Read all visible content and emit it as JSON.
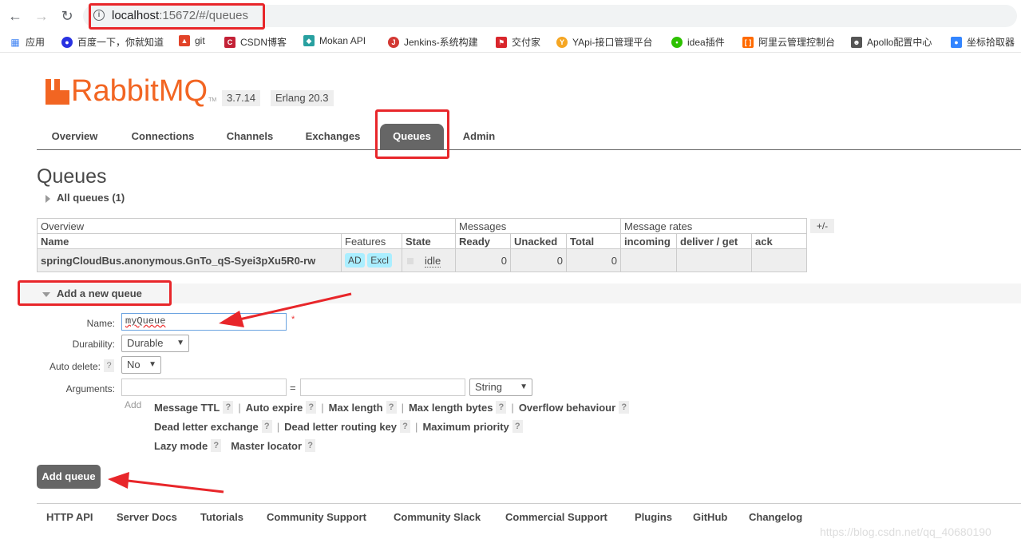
{
  "browser": {
    "url_host": "localhost",
    "url_rest": ":15672/#/queues",
    "bookmarks": [
      {
        "label": "应用",
        "icon": "apps-grid-icon",
        "color": "#4285f4"
      },
      {
        "label": "百度一下，你就知道",
        "icon": "baidu-paw-icon",
        "color": "#2932e1"
      },
      {
        "label": "git",
        "icon": "gitlab-fox-icon",
        "color": "#e24329"
      },
      {
        "label": "CSDN博客",
        "icon": "csdn-c-icon",
        "color": "#c32136"
      },
      {
        "label": "Mokan API",
        "icon": "mokan-diamond-icon",
        "color": "#28a0a0"
      },
      {
        "label": "Jenkins-系统构建",
        "icon": "jenkins-butler-icon",
        "color": "#d33833"
      },
      {
        "label": "交付家",
        "icon": "jiaofujia-flag-icon",
        "color": "#d9262c"
      },
      {
        "label": "YApi-接口管理平台",
        "icon": "yapi-y-icon",
        "color": "#f5a623"
      },
      {
        "label": "idea插件",
        "icon": "wechat-bubble-icon",
        "color": "#2dc100"
      },
      {
        "label": "阿里云管理控制台",
        "icon": "aliyun-bracket-icon",
        "color": "#ff6a00"
      },
      {
        "label": "Apollo配置中心",
        "icon": "apollo-people-icon",
        "color": "#555555"
      },
      {
        "label": "坐标拾取器",
        "icon": "map-pin-icon",
        "color": "#3385ff"
      }
    ]
  },
  "app": {
    "logo_text": "RabbitMQ",
    "logo_tm": "TM",
    "version": "3.7.14",
    "erlang": "Erlang 20.3"
  },
  "tabs": [
    "Overview",
    "Connections",
    "Channels",
    "Exchanges",
    "Queues",
    "Admin"
  ],
  "active_tab": "Queues",
  "page": {
    "title": "Queues",
    "all_queues": "All queues (1)"
  },
  "table": {
    "group_headers": [
      "Overview",
      "Messages",
      "Message rates"
    ],
    "plus_minus": "+/-",
    "columns": [
      "Name",
      "Features",
      "State",
      "Ready",
      "Unacked",
      "Total",
      "incoming",
      "deliver / get",
      "ack"
    ],
    "rows": [
      {
        "name": "springCloudBus.anonymous.GnTo_qS-Syei3pXu5R0-rw",
        "features": [
          "AD",
          "Excl"
        ],
        "state": "idle",
        "ready": "0",
        "unacked": "0",
        "total": "0",
        "incoming": "",
        "deliver_get": "",
        "ack": ""
      }
    ]
  },
  "add_queue": {
    "section_title": "Add a new queue",
    "name_label": "Name:",
    "name_value": "myQueue",
    "required_mark": "*",
    "durability_label": "Durability:",
    "durability_value": "Durable",
    "auto_delete_label": "Auto delete:",
    "auto_delete_help": "?",
    "auto_delete_value": "No",
    "arguments_label": "Arguments:",
    "equals": "=",
    "arg_type_value": "String",
    "add_label": "Add",
    "arg_links_row1": [
      "Message TTL",
      "Auto expire",
      "Max length",
      "Max length bytes",
      "Overflow behaviour"
    ],
    "arg_links_row2": [
      "Dead letter exchange",
      "Dead letter routing key",
      "Maximum priority"
    ],
    "arg_links_row3": [
      "Lazy mode",
      "Master locator"
    ],
    "help_mark": "?",
    "separator": "|",
    "submit_label": "Add queue"
  },
  "footer": {
    "links": [
      "HTTP API",
      "Server Docs",
      "Tutorials",
      "Community Support",
      "Community Slack",
      "Commercial Support",
      "Plugins",
      "GitHub",
      "Changelog"
    ]
  },
  "watermark": "https://blog.csdn.net/qq_40680190"
}
